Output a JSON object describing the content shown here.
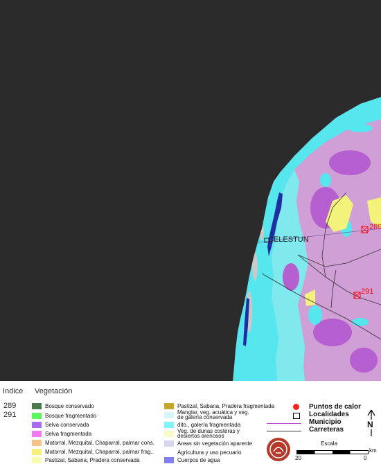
{
  "map": {
    "place_label": "CELESTUN",
    "points": [
      {
        "id": "289",
        "label": "289"
      },
      {
        "id": "291",
        "label": "291"
      }
    ],
    "colors": {
      "background": "#2b2b2b",
      "mangrove_light": "#cfe9ea",
      "cyan": "#55e6ee",
      "lilac": "#cf9fd6",
      "magenta": "#b65fd1",
      "yellow": "#f3f27a",
      "gray": "#c9c9c9",
      "water": "#1f2fa0",
      "hotspot": "#ff0000"
    }
  },
  "legend": {
    "indice_header": "Indice",
    "vegetacion_header": "Vegetación",
    "indices": [
      "289",
      "291"
    ],
    "col1": [
      {
        "label": "Bosque conservado",
        "color": "#4a7a4a"
      },
      {
        "label": "Bosque fragmentado",
        "color": "#5df55d"
      },
      {
        "label": "Selva conservada",
        "color": "#a66cf0"
      },
      {
        "label": "Selva fragmentada",
        "color": "#f07bf0"
      },
      {
        "label": "Matorral, Mezquital, Chaparral, palmar cons.",
        "color": "#f5c28a"
      },
      {
        "label": "Matorral, Mezquital, Chaparral, palmar frag..",
        "color": "#f7f07a"
      },
      {
        "label": "Pastizal, Sabana, Pradera conservada",
        "color": "#fafab0"
      }
    ],
    "col2": [
      {
        "label": "Pastizal, Sabana, Pradera fragmentada",
        "color": "#c9a52a"
      },
      {
        "label": "Manglar, veg. acuática y veg.",
        "label2": "de galería conservada",
        "color": "#d8f6f6"
      },
      {
        "label": "dito., galería fragmentada",
        "color": "#7ff3f5"
      },
      {
        "label": "Veg. de dunas costeras y",
        "label2": "desiertos arenosos",
        "color": "#fafac4"
      },
      {
        "label": "Areas sin vegetación aparente",
        "color": "#d6d6f0"
      },
      {
        "label": "Agricultura y uso pecuario",
        "color": "#ffffff"
      },
      {
        "label": "Cuerpos de agua",
        "color": "#8080f0"
      }
    ],
    "symbols": {
      "puntos": "Puntos de calor",
      "localidades": "Localidades",
      "municipio": "Municipio",
      "carreteras": "Carreteras"
    },
    "scale": {
      "title": "Escala",
      "left": "20",
      "right": "0",
      "unit": "km"
    },
    "north": "N"
  }
}
